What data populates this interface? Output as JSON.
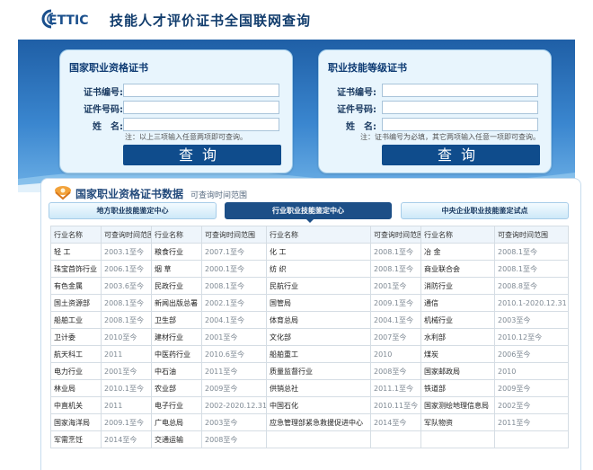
{
  "header": {
    "logo_text": "ETTIC",
    "title": "技能人才评价证书全国联网查询"
  },
  "cards": [
    {
      "title": "国家职业资格证书",
      "fields": [
        {
          "label": "证书编号:",
          "value": ""
        },
        {
          "label": "证件号码:",
          "value": ""
        },
        {
          "label": "姓　名:",
          "value": ""
        }
      ],
      "note": "注：以上三项输入任意两项即可查询。",
      "button": "查询"
    },
    {
      "title": "职业技能等级证书",
      "fields": [
        {
          "label": "证书编号:",
          "value": ""
        },
        {
          "label": "证件号码:",
          "value": ""
        },
        {
          "label": "姓　名:",
          "value": ""
        }
      ],
      "note": "注：证书编号为必填，其它两项输入任意一项即可查询。",
      "button": "查询"
    }
  ],
  "section": {
    "title": "国家职业资格证书数据",
    "subtitle": "可查询时间范围"
  },
  "tabs": [
    {
      "label": "地方职业技能鉴定中心",
      "active": false
    },
    {
      "label": "行业职业技能鉴定中心",
      "active": true
    },
    {
      "label": "中央企业职业技能鉴定试点",
      "active": false
    }
  ],
  "table": {
    "headers": [
      "行业名称",
      "可查询时间范围",
      "行业名称",
      "可查询时间范围",
      "行业名称",
      "可查询时间范围",
      "行业名称",
      "可查询时间范围"
    ],
    "rows": [
      [
        "轻 工",
        "2003.1至今",
        "粮食行业",
        "2007.1至今",
        "化 工",
        "2008.1至今",
        "冶 金",
        "2008.1至今"
      ],
      [
        "珠宝首饰行业",
        "2006.1至今",
        "烟 草",
        "2000.1至今",
        "纺 织",
        "2008.1至今",
        "商业联合会",
        "2008.1至今"
      ],
      [
        "有色金属",
        "2003.6至今",
        "民政行业",
        "2008.1至今",
        "民航行业",
        "2001至今",
        "消防行业",
        "2008.8至今"
      ],
      [
        "国土资源部",
        "2008.1至今",
        "新闻出版总署",
        "2002.1至今",
        "国管局",
        "2009.1至今",
        "通信",
        "2010.1-2020.12.31"
      ],
      [
        "船舶工业",
        "2008.1至今",
        "卫生部",
        "2004.1至今",
        "体育总局",
        "2004.1至今",
        "机械行业",
        "2003至今"
      ],
      [
        "卫计委",
        "2010至今",
        "建材行业",
        "2001至今",
        "文化部",
        "2007至今",
        "水利部",
        "2010.12至今"
      ],
      [
        "航天科工",
        "2011",
        "中医药行业",
        "2010.6至今",
        "船舶重工",
        "2010",
        "煤炭",
        "2006至今"
      ],
      [
        "电力行业",
        "2001至今",
        "中石油",
        "2011至今",
        "质量监督行业",
        "2008至今",
        "国家邮政局",
        "2010"
      ],
      [
        "林业局",
        "2010.1至今",
        "农业部",
        "2009至今",
        "供销总社",
        "2011.1至今",
        "铁道部",
        "2009至今"
      ],
      [
        "中直机关",
        "2011",
        "电子行业",
        "2002-2020.12.31",
        "中国石化",
        "2010.11至今",
        "国家测绘地理信息局",
        "2002至今"
      ],
      [
        "国家海洋局",
        "2009.1至今",
        "广电总局",
        "2003至今",
        "应急管理部紧急救援促进中心",
        "2014至今",
        "军队物资",
        "2011至今"
      ],
      [
        "军需烹饪",
        "2014至今",
        "交通运输",
        "2008至今",
        "",
        "",
        "",
        ""
      ]
    ]
  },
  "colors": {
    "primary": "#0f4c8c",
    "banner_top": "#1f5fa6",
    "card_bg": "#e8f5fd"
  }
}
